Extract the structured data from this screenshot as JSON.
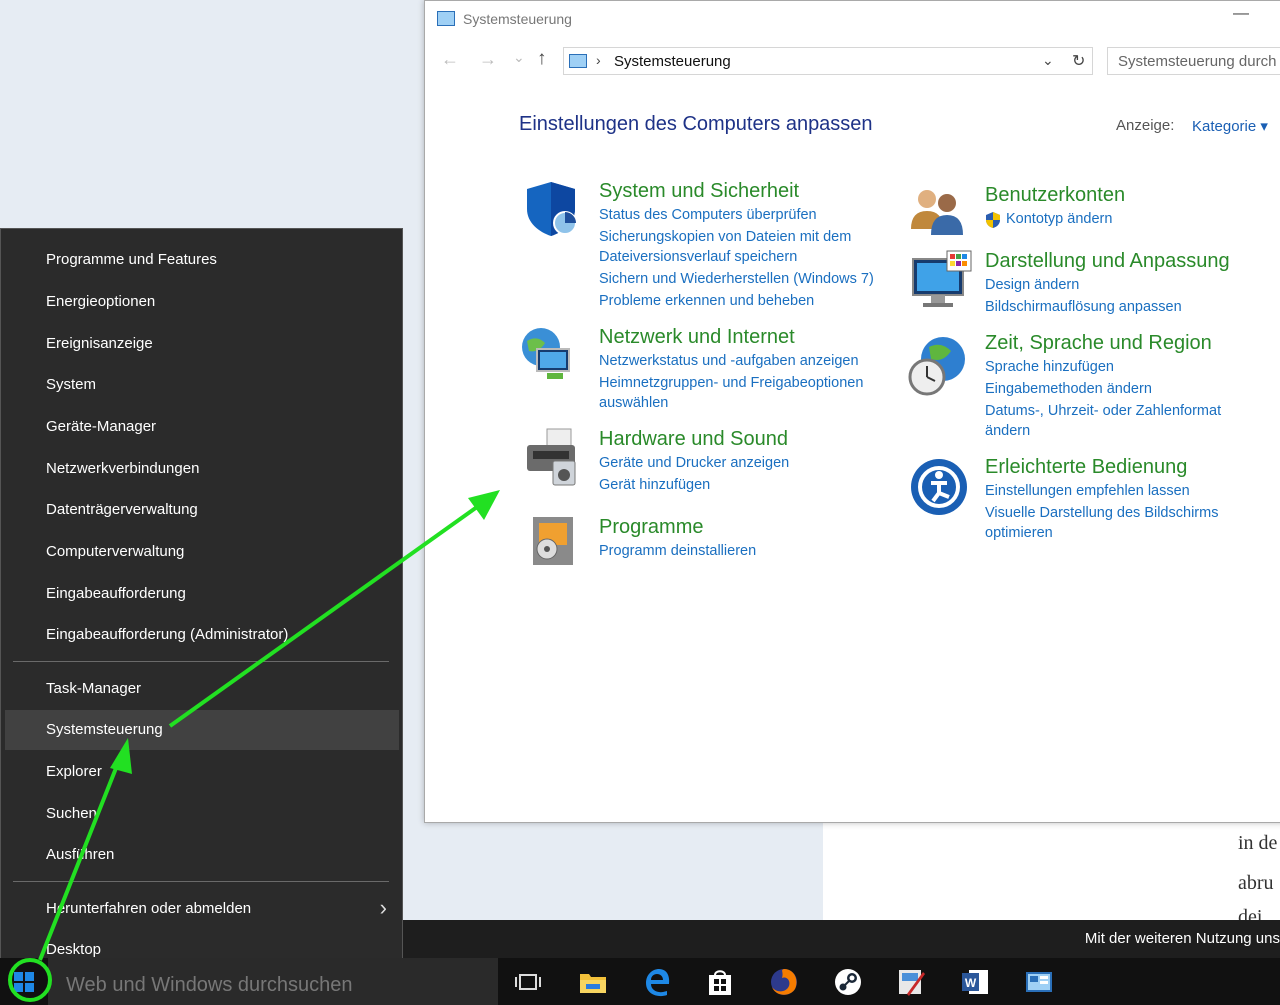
{
  "background": {
    "lines": [
      "in de",
      "abru",
      "dei"
    ],
    "cookie_text": "Mit der weiteren Nutzung uns"
  },
  "control_panel": {
    "title": "Systemsteuerung",
    "minimize_glyph": "—",
    "nav": {
      "back": "←",
      "forward": "→",
      "recent": "⌄",
      "up": "↑"
    },
    "address": "Systemsteuerung",
    "address_chevron": "›",
    "address_dropdown": "⌄",
    "refresh": "↻",
    "search_placeholder": "Systemsteuerung durch",
    "heading": "Einstellungen des Computers anpassen",
    "view_label": "Anzeige:",
    "view_value": "Kategorie ▾",
    "categories": [
      {
        "title": "System und Sicherheit",
        "links": [
          "Status des Computers überprüfen",
          "Sicherungskopien von Dateien mit dem Dateiversionsverlauf speichern",
          "Sichern und Wiederherstellen (Windows 7)",
          "Probleme erkennen und beheben"
        ]
      },
      {
        "title": "Netzwerk und Internet",
        "links": [
          "Netzwerkstatus und -aufgaben anzeigen",
          "Heimnetzgruppen- und Freigabeoptionen auswählen"
        ]
      },
      {
        "title": "Hardware und Sound",
        "links": [
          "Geräte und Drucker anzeigen",
          "Gerät hinzufügen"
        ]
      },
      {
        "title": "Programme",
        "links": [
          "Programm deinstallieren"
        ]
      },
      {
        "title": "Benutzerkonten",
        "links": [
          "Kontotyp ändern"
        ]
      },
      {
        "title": "Darstellung und Anpassung",
        "links": [
          "Design ändern",
          "Bildschirmauflösung anpassen"
        ]
      },
      {
        "title": "Zeit, Sprache und Region",
        "links": [
          "Sprache hinzufügen",
          "Eingabemethoden ändern",
          "Datums-, Uhrzeit- oder Zahlenformat ändern"
        ]
      },
      {
        "title": "Erleichterte Bedienung",
        "links": [
          "Einstellungen empfehlen lassen",
          "Visuelle Darstellung des Bildschirms optimieren"
        ]
      }
    ]
  },
  "context_menu": {
    "items": [
      "Programme und Features",
      "Energieoptionen",
      "Ereignisanzeige",
      "System",
      "Geräte-Manager",
      "Netzwerkverbindungen",
      "Datenträgerverwaltung",
      "Computerverwaltung",
      "Eingabeaufforderung",
      "Eingabeaufforderung (Administrator)",
      "Task-Manager",
      "Systemsteuerung",
      "Explorer",
      "Suchen",
      "Ausführen",
      "Herunterfahren oder abmelden",
      "Desktop"
    ],
    "submenu_arrow": "›"
  },
  "taskbar": {
    "search_placeholder": "Web und Windows durchsuchen",
    "icons": [
      "task-view-icon",
      "file-explorer-icon",
      "edge-icon",
      "store-icon",
      "firefox-icon",
      "steam-icon",
      "paint-icon",
      "word-icon",
      "control-panel-icon"
    ]
  },
  "colors": {
    "heading": "#1e3287",
    "category_title": "#2a8a2a",
    "link": "#1a6fc0",
    "annotation": "#22e022",
    "menu_bg": "#2b2b2b"
  }
}
